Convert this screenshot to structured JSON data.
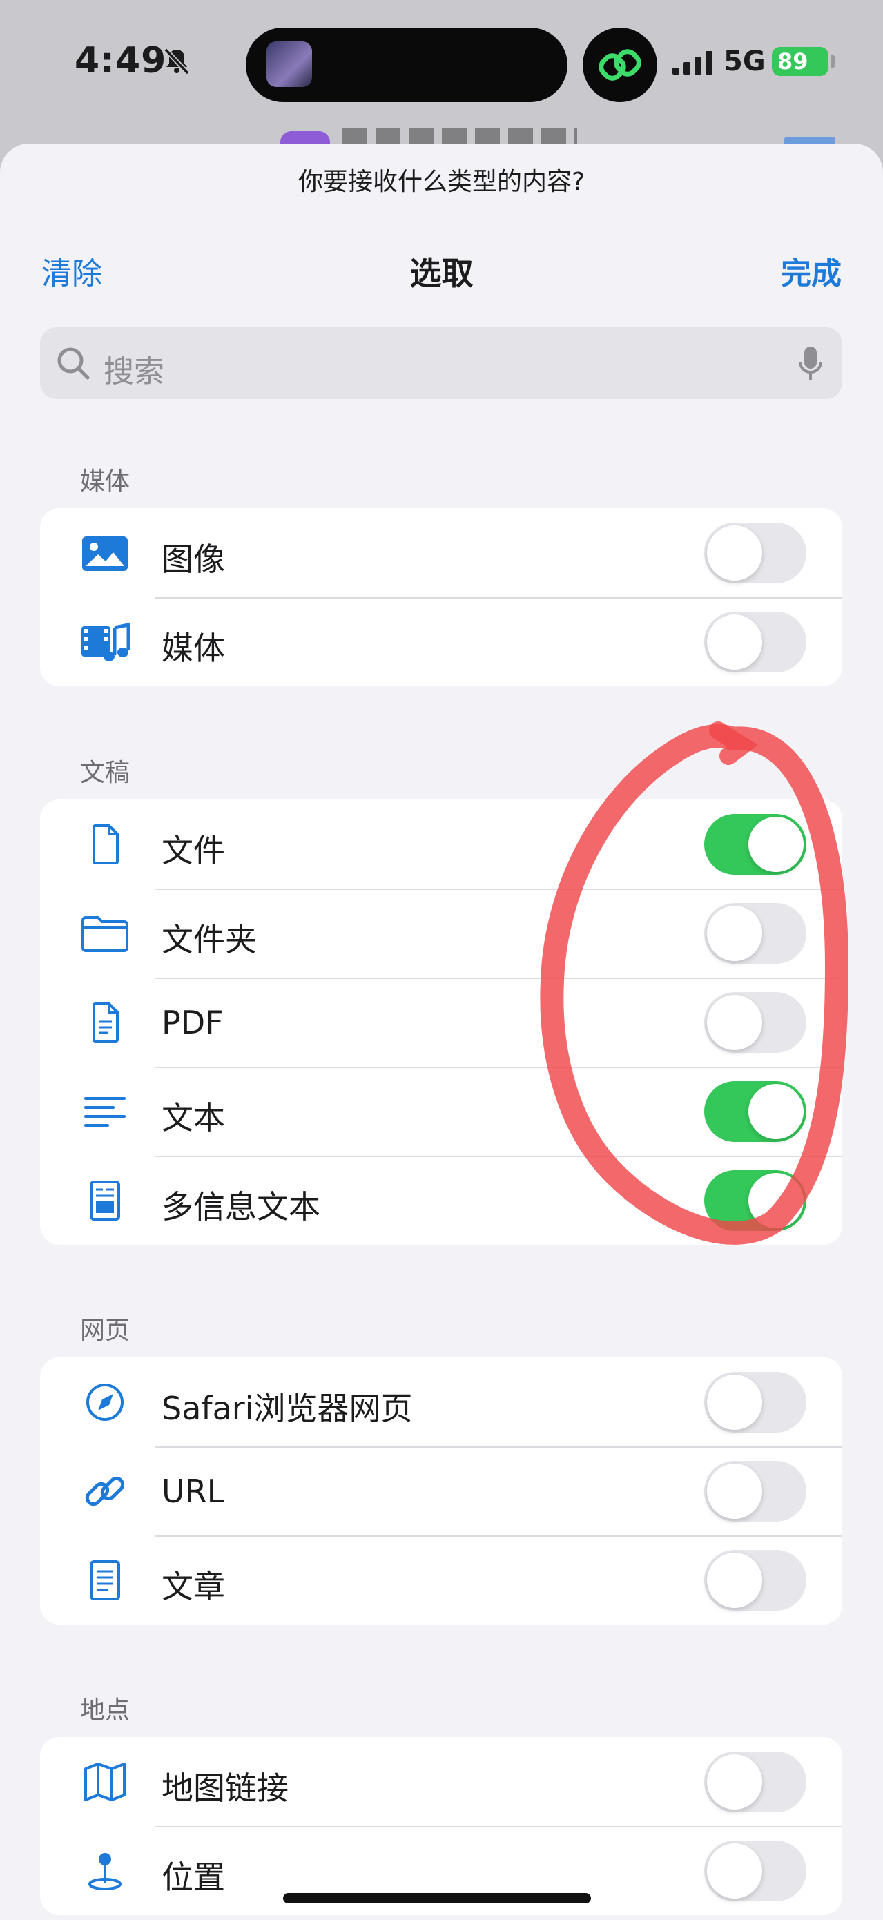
{
  "status_bar": {
    "time": "4:49",
    "network": "5G",
    "battery": "89"
  },
  "sheet": {
    "prompt": "你要接收什么类型的内容?",
    "nav": {
      "clear": "清除",
      "title": "选取",
      "done": "完成"
    },
    "search": {
      "placeholder": "搜索"
    }
  },
  "sections": [
    {
      "label": "媒体",
      "rows": [
        {
          "label": "图像",
          "icon": "photo-icon",
          "on": false
        },
        {
          "label": "媒体",
          "icon": "media-icon",
          "on": false
        }
      ]
    },
    {
      "label": "文稿",
      "rows": [
        {
          "label": "文件",
          "icon": "file-icon",
          "on": true
        },
        {
          "label": "文件夹",
          "icon": "folder-icon",
          "on": false
        },
        {
          "label": "PDF",
          "icon": "pdf-document-icon",
          "on": false
        },
        {
          "label": "文本",
          "icon": "text-lines-icon",
          "on": true
        },
        {
          "label": "多信息文本",
          "icon": "rich-text-icon",
          "on": true
        }
      ]
    },
    {
      "label": "网页",
      "rows": [
        {
          "label": "Safari浏览器网页",
          "icon": "safari-compass-icon",
          "on": false
        },
        {
          "label": "URL",
          "icon": "link-icon",
          "on": false
        },
        {
          "label": "文章",
          "icon": "article-icon",
          "on": false
        }
      ]
    },
    {
      "label": "地点",
      "rows": [
        {
          "label": "地图链接",
          "icon": "map-icon",
          "on": false
        },
        {
          "label": "位置",
          "icon": "location-pin-icon",
          "on": false
        }
      ]
    }
  ],
  "colors": {
    "accent": "#1e7ad9",
    "toggle_on": "#34c759",
    "annotation": "#f0484a"
  }
}
